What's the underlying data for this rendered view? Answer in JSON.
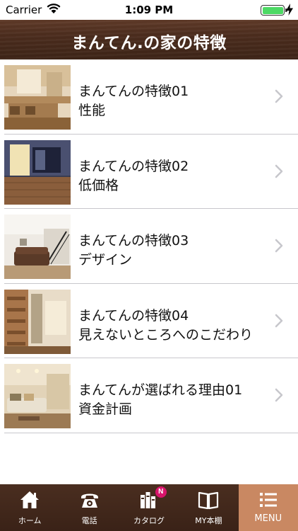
{
  "status_bar": {
    "carrier": "Carrier",
    "time": "1:09 PM",
    "battery_color": "#4cd964"
  },
  "header": {
    "title": "まんてん.の家の特徴",
    "background": "#4b2c1d"
  },
  "items": [
    {
      "title": "まんてんの特徴01",
      "subtitle": "性能",
      "thumb_icon": "kitchen-photo"
    },
    {
      "title": "まんてんの特徴02",
      "subtitle": "低価格",
      "thumb_icon": "deck-photo"
    },
    {
      "title": "まんてんの特徴03",
      "subtitle": "デザイン",
      "thumb_icon": "living-room-photo"
    },
    {
      "title": "まんてんの特徴04",
      "subtitle": "見えないところへのこだわり",
      "thumb_icon": "staircase-photo"
    },
    {
      "title": "まんてんが選ばれる理由01",
      "subtitle": "資金計画",
      "thumb_icon": "sofa-room-photo"
    }
  ],
  "tab_bar": {
    "active_color": "#c98862",
    "tabs": [
      {
        "label": "ホーム",
        "icon": "home-icon"
      },
      {
        "label": "電話",
        "icon": "phone-icon"
      },
      {
        "label": "カタログ",
        "icon": "catalog-icon",
        "badge": "N"
      },
      {
        "label": "MY本棚",
        "icon": "book-icon"
      },
      {
        "label": "MENU",
        "icon": "menu-icon"
      }
    ]
  }
}
